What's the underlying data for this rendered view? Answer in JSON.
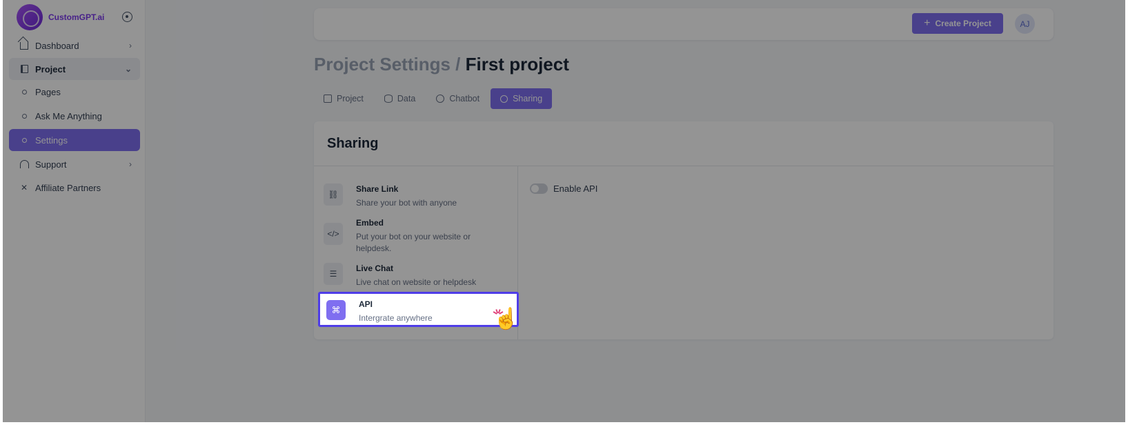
{
  "sidebar": {
    "brand": "CustomGPT.ai",
    "items": [
      {
        "label": "Dashboard"
      },
      {
        "label": "Project"
      },
      {
        "label": "Pages"
      },
      {
        "label": "Ask Me Anything"
      },
      {
        "label": "Settings"
      },
      {
        "label": "Support"
      },
      {
        "label": "Affiliate Partners"
      }
    ]
  },
  "header": {
    "create_label": "Create Project",
    "avatar_initials": "AJ"
  },
  "page": {
    "title_prefix": "Project Settings /",
    "title_current": "First project"
  },
  "tabs": [
    {
      "label": "Project"
    },
    {
      "label": "Data"
    },
    {
      "label": "Chatbot"
    },
    {
      "label": "Sharing"
    }
  ],
  "card": {
    "title": "Sharing",
    "options": [
      {
        "title": "Share Link",
        "subtitle": "Share your bot with anyone",
        "icon": "link-icon"
      },
      {
        "title": "Embed",
        "subtitle": "Put your bot on your website or helpdesk.",
        "icon": "code-icon"
      },
      {
        "title": "Live Chat",
        "subtitle": "Live chat on website or helpdesk",
        "icon": "chat-icon"
      },
      {
        "title": "API",
        "subtitle": "Intergrate anywhere",
        "icon": "api-icon"
      }
    ],
    "toggle_label": "Enable API",
    "toggle_state": "off"
  },
  "colors": {
    "accent": "#7f6ef0",
    "highlight_border": "#4f3de8"
  }
}
